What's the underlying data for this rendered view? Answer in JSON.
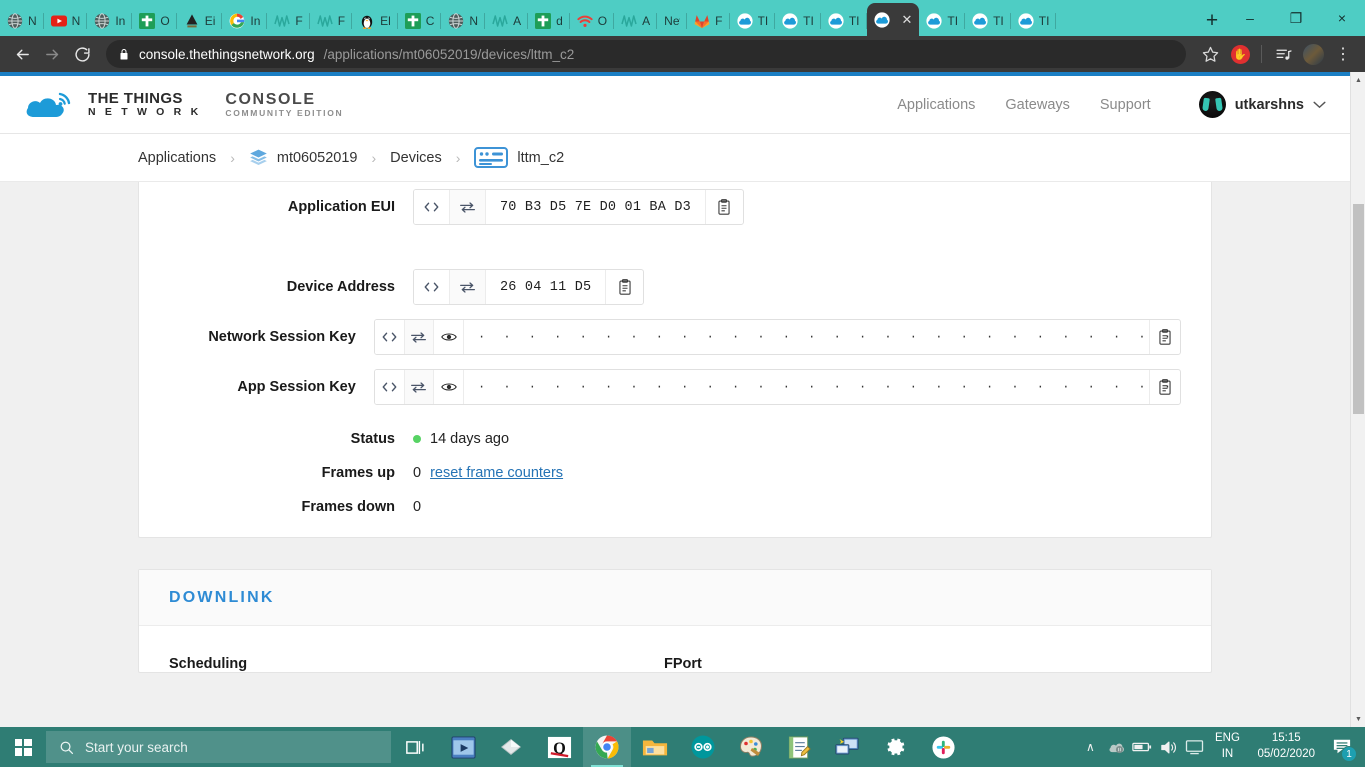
{
  "browser": {
    "tabs": [
      {
        "title": "N",
        "icon": "globe-dark",
        "active": false
      },
      {
        "title": "N",
        "icon": "youtube",
        "active": false
      },
      {
        "title": "In",
        "icon": "globe-dark",
        "active": false
      },
      {
        "title": "O",
        "icon": "green-cross",
        "active": false
      },
      {
        "title": "Ei",
        "icon": "triangle-dark",
        "active": false
      },
      {
        "title": "In",
        "icon": "google",
        "active": false
      },
      {
        "title": "F",
        "icon": "wave-teal",
        "active": false
      },
      {
        "title": "F",
        "icon": "wave-teal",
        "active": false
      },
      {
        "title": "El",
        "icon": "penguin",
        "active": false
      },
      {
        "title": "C",
        "icon": "green-cross",
        "active": false
      },
      {
        "title": "N",
        "icon": "globe-dark",
        "active": false
      },
      {
        "title": "A",
        "icon": "wave-teal",
        "active": false
      },
      {
        "title": "d",
        "icon": "green-cross",
        "active": false
      },
      {
        "title": "O",
        "icon": "wifi-red",
        "active": false
      },
      {
        "title": "A",
        "icon": "wave-teal",
        "active": false
      },
      {
        "title": "New T",
        "icon": "none",
        "active": false
      },
      {
        "title": "F",
        "icon": "gitlab",
        "active": false
      },
      {
        "title": "TI",
        "icon": "ttn-cloud",
        "active": false
      },
      {
        "title": "TI",
        "icon": "ttn-cloud",
        "active": false
      },
      {
        "title": "TI",
        "icon": "ttn-cloud",
        "active": false
      },
      {
        "title": "",
        "icon": "ttn-cloud",
        "active": true
      },
      {
        "title": "TI",
        "icon": "ttn-cloud",
        "active": false
      },
      {
        "title": "TI",
        "icon": "ttn-cloud",
        "active": false
      },
      {
        "title": "TI",
        "icon": "ttn-cloud",
        "active": false
      }
    ],
    "new_tab_label": "+",
    "window_controls": {
      "minimize": "–",
      "maximize": "❐",
      "close": "×"
    },
    "nav": {
      "back": "←",
      "forward": "→",
      "reload": "↻"
    },
    "omnibox": {
      "lock_icon": "lock-icon",
      "host": "console.thethingsnetwork.org",
      "path": "/applications/mt06052019/devices/lttm_c2"
    },
    "toolbar_icons": {
      "bookmark": "☆",
      "extension": "✋",
      "playlist": "☰",
      "menu": "⋮"
    }
  },
  "ttn": {
    "logo": {
      "line1": "THE THINGS",
      "line2": "N E T W O R K",
      "console": "CONSOLE",
      "edition": "COMMUNITY EDITION"
    },
    "nav": [
      {
        "label": "Applications"
      },
      {
        "label": "Gateways"
      },
      {
        "label": "Support"
      }
    ],
    "user": {
      "name": "utkarshns",
      "caret": "∨"
    }
  },
  "breadcrumb": {
    "separator": "›",
    "items": [
      {
        "label": "Applications",
        "icon": "none"
      },
      {
        "label": "mt06052019",
        "icon": "layers-icon"
      },
      {
        "label": "Devices",
        "icon": "none"
      },
      {
        "label": "lttm_c2",
        "icon": "device-card-icon"
      }
    ]
  },
  "device": {
    "fields": [
      {
        "label": "Application EUI",
        "value": "70 B3 D5 7E D0 01 BA D3",
        "masked": false,
        "buttons": [
          "code-icon",
          "swap-icon"
        ],
        "copy": "clipboard-icon"
      },
      {
        "label": "Device Address",
        "value": "26 04 11 D5",
        "masked": false,
        "buttons": [
          "code-icon",
          "swap-icon"
        ],
        "copy": "clipboard-icon"
      },
      {
        "label": "Network Session Key",
        "value": "· · · · · · · · · · · · · · · · · · · · · · · · · · · · · · · ·",
        "masked": true,
        "buttons": [
          "code-icon",
          "swap-icon",
          "eye-icon"
        ],
        "copy": "clipboard-icon"
      },
      {
        "label": "App Session Key",
        "value": "· · · · · · · · · · · · · · · · · · · · · · · · · · · · · · · ·",
        "masked": true,
        "buttons": [
          "code-icon",
          "swap-icon",
          "eye-icon"
        ],
        "copy": "clipboard-icon"
      }
    ],
    "status": {
      "label": "Status",
      "value": "14 days ago",
      "indicator_color": "#57d364"
    },
    "frames_up": {
      "label": "Frames up",
      "value": "0",
      "action_label": "reset frame counters"
    },
    "frames_down": {
      "label": "Frames down",
      "value": "0"
    }
  },
  "downlink": {
    "title": "DOWNLINK",
    "scheduling_label": "Scheduling",
    "fport_label": "FPort"
  },
  "taskbar": {
    "search_placeholder": "Start your search",
    "search_icon": "search-icon",
    "start_icon": "windows-icon",
    "taskview_icon": "task-view-icon",
    "apps": [
      {
        "name": "media-player-app"
      },
      {
        "name": "diamond-app"
      },
      {
        "name": "qgis-app"
      },
      {
        "name": "chrome-app",
        "active": true
      },
      {
        "name": "file-explorer-app"
      },
      {
        "name": "arduino-app"
      },
      {
        "name": "paint-app"
      },
      {
        "name": "notepad-app"
      },
      {
        "name": "remote-desktop-app"
      },
      {
        "name": "settings-app"
      },
      {
        "name": "slack-app"
      }
    ],
    "tray": {
      "chevron": "∧",
      "language_1": "ENG",
      "language_2": "IN",
      "time": "15:15",
      "date": "05/02/2020",
      "notification_count": "1"
    }
  },
  "colors": {
    "tab_strip": "#4ECDC4",
    "chrome_bg": "#3a3a3a",
    "taskbar": "#2f7d74",
    "accent_blue": "#2e8bd4",
    "link_blue": "#2573b5",
    "status_green": "#57d364",
    "top_rule": "#1b7fc4"
  }
}
